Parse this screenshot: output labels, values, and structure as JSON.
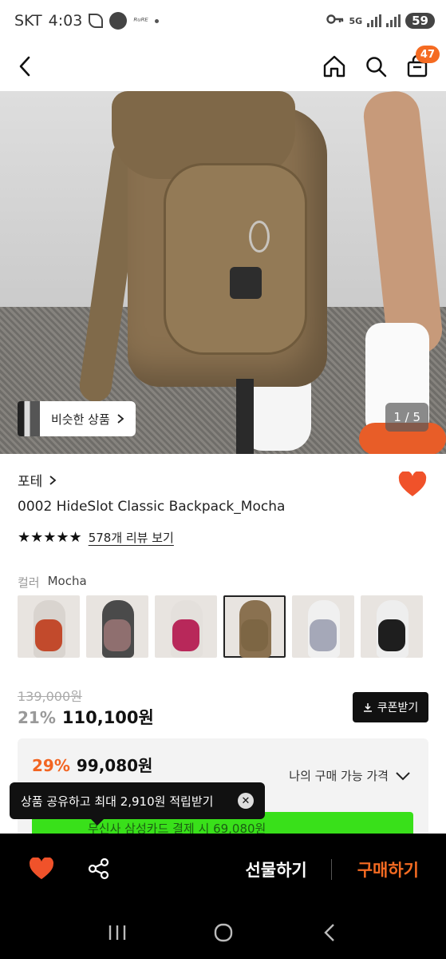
{
  "status_bar": {
    "carrier": "SKT",
    "time": "4:03",
    "network": "5G",
    "battery": "59"
  },
  "header": {
    "cart_badge": "47"
  },
  "hero": {
    "similar_label": "비슷한 상품",
    "page_indicator": "1 / 5"
  },
  "product": {
    "brand": "포테",
    "title": "0002 HideSlot Classic Backpack_Mocha",
    "stars": "★★★★★",
    "review_link": "578개 리뷰 보기",
    "color_label": "컬러",
    "color_value": "Mocha",
    "color_options": [
      {
        "shirt": "#d9d4cf",
        "bag": "#c24a2c"
      },
      {
        "shirt": "#4a4a4a",
        "bag": "#8f6f6f"
      },
      {
        "shirt": "#e4e0dc",
        "bag": "#b8285a"
      },
      {
        "shirt": "#8a7150",
        "bag": "#7d6644"
      },
      {
        "shirt": "#f0f0f0",
        "bag": "#a5a8b8"
      },
      {
        "shirt": "#eeeeee",
        "bag": "#1e1e1e"
      }
    ],
    "original_price": "139,000원",
    "discount": "21%",
    "price": "110,100원",
    "coupon_label": "쿠폰받기"
  },
  "my_price": {
    "discount": "29%",
    "price": "99,080원",
    "label": "나의 구매 가능 가격"
  },
  "tooltip": {
    "text": "상품 공유하고 최대 2,910원 적립받기"
  },
  "banner": {
    "text": "무신사 삼성카드 결제 시 69,080원"
  },
  "bottom_bar": {
    "gift_label": "선물하기",
    "buy_label": "구매하기"
  },
  "colors": {
    "accent": "#f56b22",
    "heart": "#f0522a",
    "green_banner": "#39e01a"
  }
}
